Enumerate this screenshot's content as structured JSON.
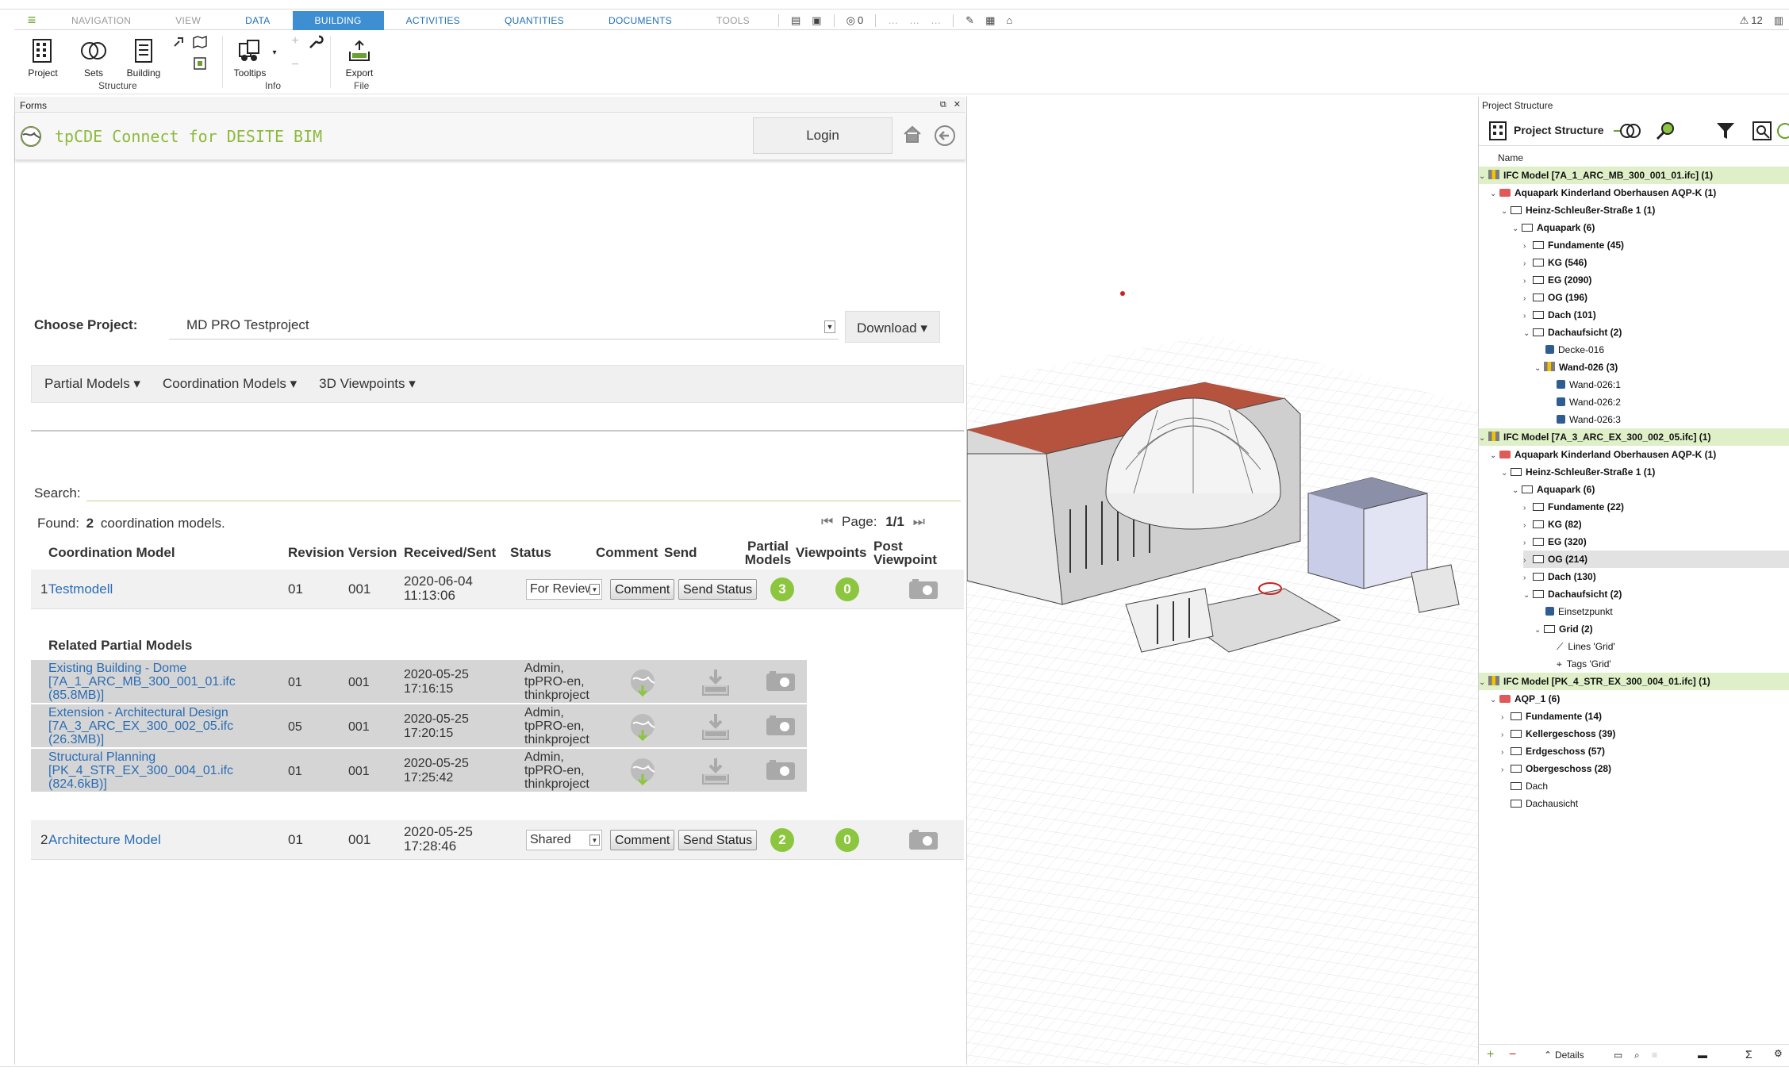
{
  "menu": {
    "tabs": [
      "NAVIGATION",
      "VIEW",
      "DATA",
      "BUILDING",
      "ACTIVITIES",
      "QUANTITIES",
      "DOCUMENTS",
      "TOOLS"
    ],
    "active": "BUILDING",
    "counter": "0",
    "warnings": "12"
  },
  "ribbon": {
    "buttons": {
      "project": "Project",
      "sets": "Sets",
      "building": "Building",
      "tooltips": "Tooltips",
      "export": "Export"
    },
    "groups": {
      "structure": "Structure",
      "info": "Info",
      "file": "File"
    }
  },
  "forms": {
    "title": "Forms"
  },
  "tp": {
    "title": "tpCDE Connect for DESITE BIM",
    "login": "Login"
  },
  "project": {
    "label": "Choose Project:",
    "value": "MD PRO Testproject",
    "download": "Download ▾"
  },
  "subnav": {
    "partial": "Partial Models ▾",
    "coord": "Coordination Models ▾",
    "views": "3D Viewpoints ▾"
  },
  "search": {
    "label": "Search:"
  },
  "found": {
    "prefix": "Found:",
    "count": "2",
    "suffix": "coordination models."
  },
  "pager": {
    "label": "Page:",
    "value": "1/1"
  },
  "table": {
    "headers": {
      "model": "Coordination Model",
      "revision": "Revision",
      "version": "Version",
      "received": "Received/Sent",
      "status": "Status",
      "comment": "Comment",
      "send": "Send",
      "partial1": "Partial",
      "partial2": "Models",
      "viewpoints": "Viewpoints",
      "post1": "Post",
      "post2": "Viewpoint"
    },
    "rows": [
      {
        "idx": "1",
        "name": "Testmodell",
        "revision": "01",
        "version": "001",
        "date": "2020-06-04",
        "time": "11:13:06",
        "status": "For Review",
        "comment": "Comment",
        "send": "Send Status",
        "partial": "3",
        "viewpoints": "0"
      },
      {
        "idx": "2",
        "name": "Architecture Model",
        "revision": "01",
        "version": "001",
        "date": "2020-05-25",
        "time": "17:28:46",
        "status": "Shared",
        "comment": "Comment",
        "send": "Send Status",
        "partial": "2",
        "viewpoints": "0"
      }
    ],
    "related_title": "Related Partial Models",
    "partials": [
      {
        "l1": "Existing Building - Dome",
        "l2": "[7A_1_ARC_MB_300_001_01.ifc",
        "l3": "(85.8MB)]",
        "revision": "01",
        "version": "001",
        "date": "2020-05-25",
        "time": "17:16:15",
        "u1": "Admin,",
        "u2": "tpPRO-en,",
        "u3": "thinkproject"
      },
      {
        "l1": "Extension - Architectural Design",
        "l2": "[7A_3_ARC_EX_300_002_05.ifc",
        "l3": "(26.3MB)]",
        "revision": "05",
        "version": "001",
        "date": "2020-05-25",
        "time": "17:20:15",
        "u1": "Admin,",
        "u2": "tpPRO-en,",
        "u3": "thinkproject"
      },
      {
        "l1": "Structural Planning",
        "l2": "[PK_4_STR_EX_300_004_01.ifc",
        "l3": "(824.6kB)]",
        "revision": "01",
        "version": "001",
        "date": "2020-05-25",
        "time": "17:25:42",
        "u1": "Admin,",
        "u2": "tpPRO-en,",
        "u3": "thinkproject"
      }
    ]
  },
  "tree": {
    "panel_title": "Project Structure",
    "tool_label": "Project Structure",
    "col_name": "Name",
    "nodes": [
      {
        "t": "IFC Model [7A_1_ARC_MB_300_001_01.ifc] (1)"
      },
      {
        "t": "Aquapark Kinderland Oberhausen AQP-K (1)"
      },
      {
        "t": "Heinz-Schleußer-Straße 1 (1)"
      },
      {
        "t": "Aquapark (6)"
      },
      {
        "t": "Fundamente (45)"
      },
      {
        "t": "KG (546)"
      },
      {
        "t": "EG (2090)"
      },
      {
        "t": "OG (196)"
      },
      {
        "t": "Dach (101)"
      },
      {
        "t": "Dachaufsicht (2)"
      },
      {
        "t": "Decke-016"
      },
      {
        "t": "Wand-026 (3)"
      },
      {
        "t": "Wand-026:1"
      },
      {
        "t": "Wand-026:2"
      },
      {
        "t": "Wand-026:3"
      },
      {
        "t": "IFC Model [7A_3_ARC_EX_300_002_05.ifc] (1)"
      },
      {
        "t": "Aquapark Kinderland Oberhausen AQP-K (1)"
      },
      {
        "t": "Heinz-Schleußer-Straße 1 (1)"
      },
      {
        "t": "Aquapark (6)"
      },
      {
        "t": "Fundamente (22)"
      },
      {
        "t": "KG (82)"
      },
      {
        "t": "EG (320)"
      },
      {
        "t": "OG (214)"
      },
      {
        "t": "Dach (130)"
      },
      {
        "t": "Dachaufsicht (2)"
      },
      {
        "t": "Einsetzpunkt"
      },
      {
        "t": "Grid (2)"
      },
      {
        "t": "Lines 'Grid'"
      },
      {
        "t": "Tags 'Grid'"
      },
      {
        "t": "IFC Model [PK_4_STR_EX_300_004_01.ifc] (1)"
      },
      {
        "t": "AQP_1 (6)"
      },
      {
        "t": "Fundamente (14)"
      },
      {
        "t": "Kellergeschoss (39)"
      },
      {
        "t": "Erdgeschoss (57)"
      },
      {
        "t": "Obergeschoss (28)"
      },
      {
        "t": "Dach"
      },
      {
        "t": "Dachausicht"
      }
    ],
    "details": "Details"
  }
}
